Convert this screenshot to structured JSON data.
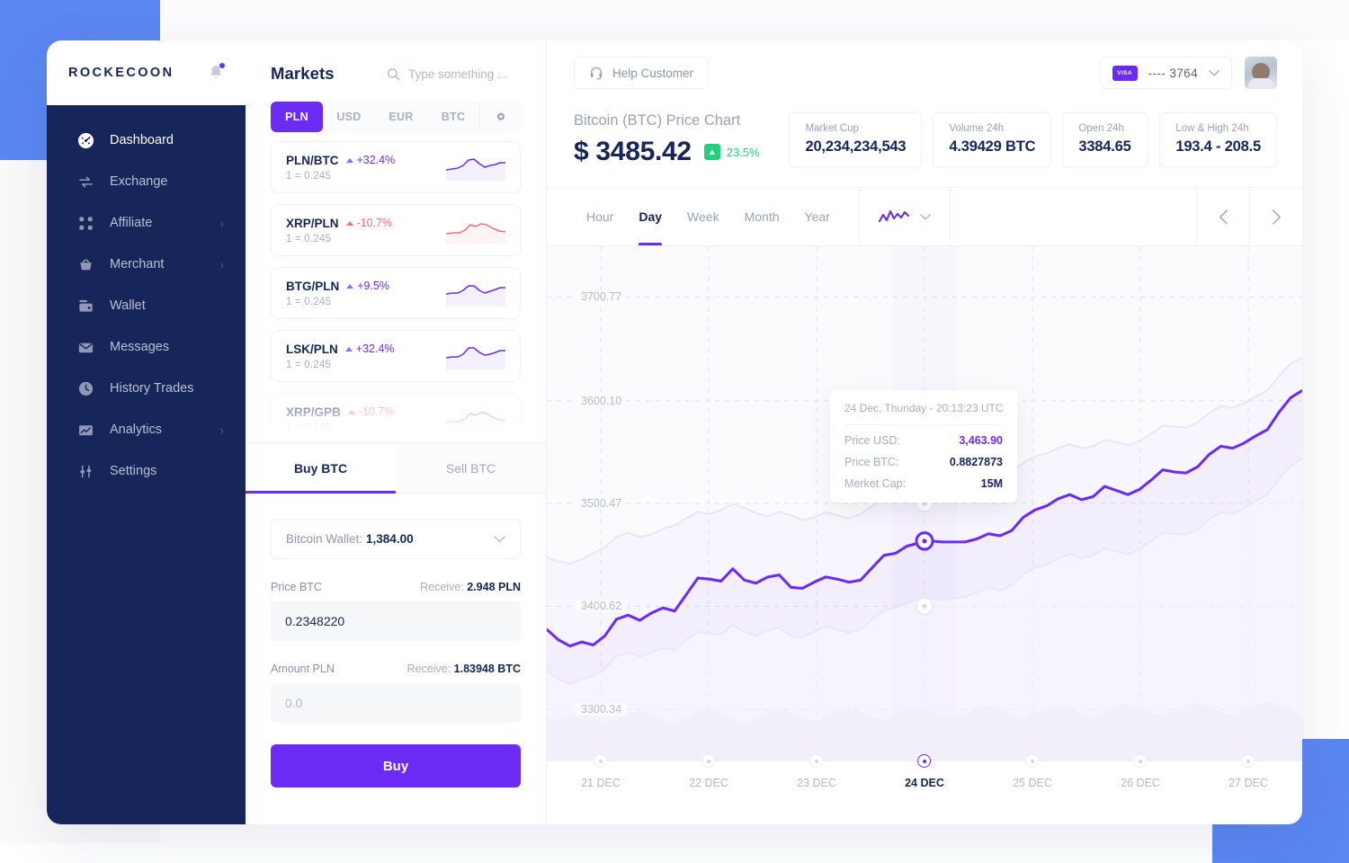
{
  "brand": {
    "logo": "ROCKECOON"
  },
  "sidebar": {
    "items": [
      {
        "label": "Dashboard",
        "icon": "dashboard-icon",
        "chevron": "",
        "active": true
      },
      {
        "label": "Exchange",
        "icon": "exchange-icon",
        "chevron": "",
        "active": false
      },
      {
        "label": "Affiliate",
        "icon": "affiliate-icon",
        "chevron": "›",
        "active": false
      },
      {
        "label": "Merchant",
        "icon": "merchant-icon",
        "chevron": "›",
        "active": false
      },
      {
        "label": "Wallet",
        "icon": "wallet-icon",
        "chevron": "",
        "active": false
      },
      {
        "label": "Messages",
        "icon": "messages-icon",
        "chevron": "",
        "active": false
      },
      {
        "label": "History Trades",
        "icon": "history-icon",
        "chevron": "",
        "active": false
      },
      {
        "label": "Analytics",
        "icon": "analytics-icon",
        "chevron": "›",
        "active": false
      },
      {
        "label": "Settings",
        "icon": "settings-icon",
        "chevron": "",
        "active": false
      }
    ]
  },
  "markets": {
    "title": "Markets",
    "search_placeholder": "Type something ...",
    "currency_tabs": [
      {
        "label": "PLN",
        "active": true
      },
      {
        "label": "USD",
        "active": false
      },
      {
        "label": "EUR",
        "active": false
      },
      {
        "label": "BTC",
        "active": false
      }
    ],
    "settings_icon": "gear-icon",
    "pairs": [
      {
        "pair": "PLN/BTC",
        "change": "+32.4%",
        "direction": "up",
        "rate": "1 = 0.245",
        "faded": false
      },
      {
        "pair": "XRP/PLN",
        "change": "-10.7%",
        "direction": "down",
        "rate": "1 = 0.245",
        "faded": false
      },
      {
        "pair": "BTG/PLN",
        "change": "+9.5%",
        "direction": "up",
        "rate": "1 = 0.245",
        "faded": false
      },
      {
        "pair": "LSK/PLN",
        "change": "+32.4%",
        "direction": "up",
        "rate": "1 = 0.245",
        "faded": false
      },
      {
        "pair": "XRP/GPB",
        "change": "-10.7%",
        "direction": "down",
        "rate": "1 = 0.245",
        "faded": true
      }
    ]
  },
  "trade": {
    "tabs": [
      {
        "label": "Buy BTC",
        "active": true
      },
      {
        "label": "Sell BTC",
        "active": false
      }
    ],
    "wallet_label": "Bitcoin Wallet:",
    "wallet_value": "1,384.00",
    "price_label": "Price BTC",
    "price_receive_label": "Receive:",
    "price_receive_value": "2.948 PLN",
    "price_value": "0.2348220",
    "amount_label": "Amount PLN",
    "amount_receive_label": "Receive:",
    "amount_receive_value": "1.83948 BTC",
    "amount_placeholder": "0.0",
    "amount_value": "",
    "submit_label": "Buy"
  },
  "topbar": {
    "help_label": "Help Customer",
    "help_icon": "headset-icon",
    "card_brand": "VISA",
    "card_number": "---- 3764",
    "avatar": "user-avatar"
  },
  "price_header": {
    "title": "Bitcoin (BTC) Price Chart",
    "price": "$ 3485.42",
    "change": "23.5%",
    "change_direction": "up",
    "change_color": "#25d07d"
  },
  "stats": [
    {
      "key": "Market Cup",
      "value": "20,234,234,543"
    },
    {
      "key": "Volume 24h",
      "value": "4.39429 BTC"
    },
    {
      "key": "Open 24h",
      "value": "3384.65"
    },
    {
      "key": "Low & High 24h",
      "value": "193.4 - 208.5"
    }
  ],
  "chart_toolbar": {
    "ranges": [
      {
        "label": "Hour",
        "active": false
      },
      {
        "label": "Day",
        "active": true
      },
      {
        "label": "Week",
        "active": false
      },
      {
        "label": "Month",
        "active": false
      },
      {
        "label": "Year",
        "active": false
      }
    ],
    "chart_type_icon": "line-chart-icon",
    "prev_icon": "chevron-left-icon",
    "next_icon": "chevron-right-icon"
  },
  "tooltip": {
    "date": "24 Dec, Thunday - 20:13:23 UTC",
    "rows": [
      {
        "key": "Price USD:",
        "value": "3,463.90",
        "accent": true
      },
      {
        "key": "Price BTC:",
        "value": "0.8827873",
        "accent": false
      },
      {
        "key": "Merket Cap:",
        "value": "15M",
        "accent": false
      }
    ]
  },
  "colors": {
    "accent": "#6c2bf5",
    "sidebar": "#16255a",
    "positive": "#25d07d",
    "negative": "#f4706e",
    "deco": "#5b87f2"
  },
  "chart_data": {
    "type": "line",
    "title": "Bitcoin (BTC) Price Chart",
    "xlabel": "",
    "ylabel": "",
    "grid": true,
    "legend": "none",
    "ylim": [
      3250,
      3750
    ],
    "ytick_labels": [
      "3700.77",
      "3600.10",
      "3500.47",
      "3400.62",
      "3300.34"
    ],
    "yticks": [
      3700.77,
      3600.1,
      3500.47,
      3400.62,
      3300.34
    ],
    "xtick_labels": [
      "21 DEC",
      "22 DEC",
      "23 DEC",
      "24 DEC",
      "25 DEC",
      "26 DEC",
      "27 DEC"
    ],
    "highlight_x": "24 DEC",
    "highlight_point": {
      "x": "24 DEC",
      "y": 3463.9
    },
    "series": [
      {
        "name": "Price USD",
        "color": "#6c2bf5",
        "values": [
          3378,
          3368,
          3362,
          3366,
          3363,
          3372,
          3388,
          3392,
          3387,
          3394,
          3399,
          3396,
          3412,
          3428,
          3427,
          3425,
          3437,
          3426,
          3423,
          3429,
          3431,
          3419,
          3418,
          3424,
          3429,
          3427,
          3424,
          3426,
          3438,
          3450,
          3452,
          3459,
          3462,
          3464,
          3463,
          3463,
          3463,
          3466,
          3471,
          3469,
          3474,
          3487,
          3494,
          3498,
          3505,
          3509,
          3504,
          3507,
          3517,
          3513,
          3509,
          3514,
          3523,
          3533,
          3531,
          3530,
          3536,
          3548,
          3556,
          3554,
          3559,
          3566,
          3572,
          3589,
          3603,
          3610
        ]
      },
      {
        "name": "Upper band",
        "color": "#e6e7ef",
        "values": [
          3448,
          3444,
          3442,
          3446,
          3452,
          3458,
          3468,
          3472,
          3468,
          3470,
          3476,
          3479,
          3486,
          3492,
          3490,
          3494,
          3500,
          3496,
          3491,
          3488,
          3492,
          3489,
          3484,
          3487,
          3492,
          3489,
          3486,
          3490,
          3498,
          3505,
          3508,
          3512,
          3515,
          3516,
          3515,
          3516,
          3519,
          3522,
          3527,
          3524,
          3530,
          3540,
          3546,
          3549,
          3554,
          3558,
          3554,
          3556,
          3562,
          3560,
          3557,
          3561,
          3568,
          3576,
          3575,
          3574,
          3579,
          3588,
          3595,
          3593,
          3598,
          3604,
          3610,
          3624,
          3636,
          3642
        ]
      },
      {
        "name": "Lower band",
        "color": "#edeef4",
        "values": [
          3338,
          3330,
          3325,
          3330,
          3333,
          3340,
          3352,
          3356,
          3352,
          3356,
          3360,
          3358,
          3368,
          3376,
          3374,
          3373,
          3382,
          3376,
          3372,
          3377,
          3380,
          3372,
          3370,
          3376,
          3381,
          3378,
          3375,
          3378,
          3388,
          3397,
          3399,
          3404,
          3407,
          3408,
          3407,
          3408,
          3410,
          3414,
          3419,
          3416,
          3421,
          3432,
          3438,
          3441,
          3447,
          3451,
          3447,
          3450,
          3457,
          3454,
          3451,
          3456,
          3464,
          3472,
          3471,
          3470,
          3475,
          3485,
          3492,
          3490,
          3496,
          3503,
          3509,
          3524,
          3537,
          3544
        ]
      },
      {
        "name": "Volume",
        "color": "#f1f2f7",
        "values": [
          3292,
          3290,
          3294,
          3296,
          3292,
          3288,
          3291,
          3296,
          3299,
          3295,
          3290,
          3287,
          3292,
          3298,
          3300,
          3296,
          3291,
          3288,
          3293,
          3298,
          3301,
          3297,
          3292,
          3289,
          3294,
          3299,
          3302,
          3298,
          3293,
          3290,
          3295,
          3300,
          3303,
          3299,
          3294,
          3291,
          3296,
          3301,
          3304,
          3300,
          3295,
          3292,
          3297,
          3302,
          3305,
          3301,
          3296,
          3293,
          3298,
          3303,
          3306,
          3302,
          3297,
          3294,
          3299,
          3304,
          3307,
          3303,
          3298,
          3295,
          3300,
          3305,
          3308,
          3304,
          3299,
          3296
        ]
      }
    ]
  }
}
